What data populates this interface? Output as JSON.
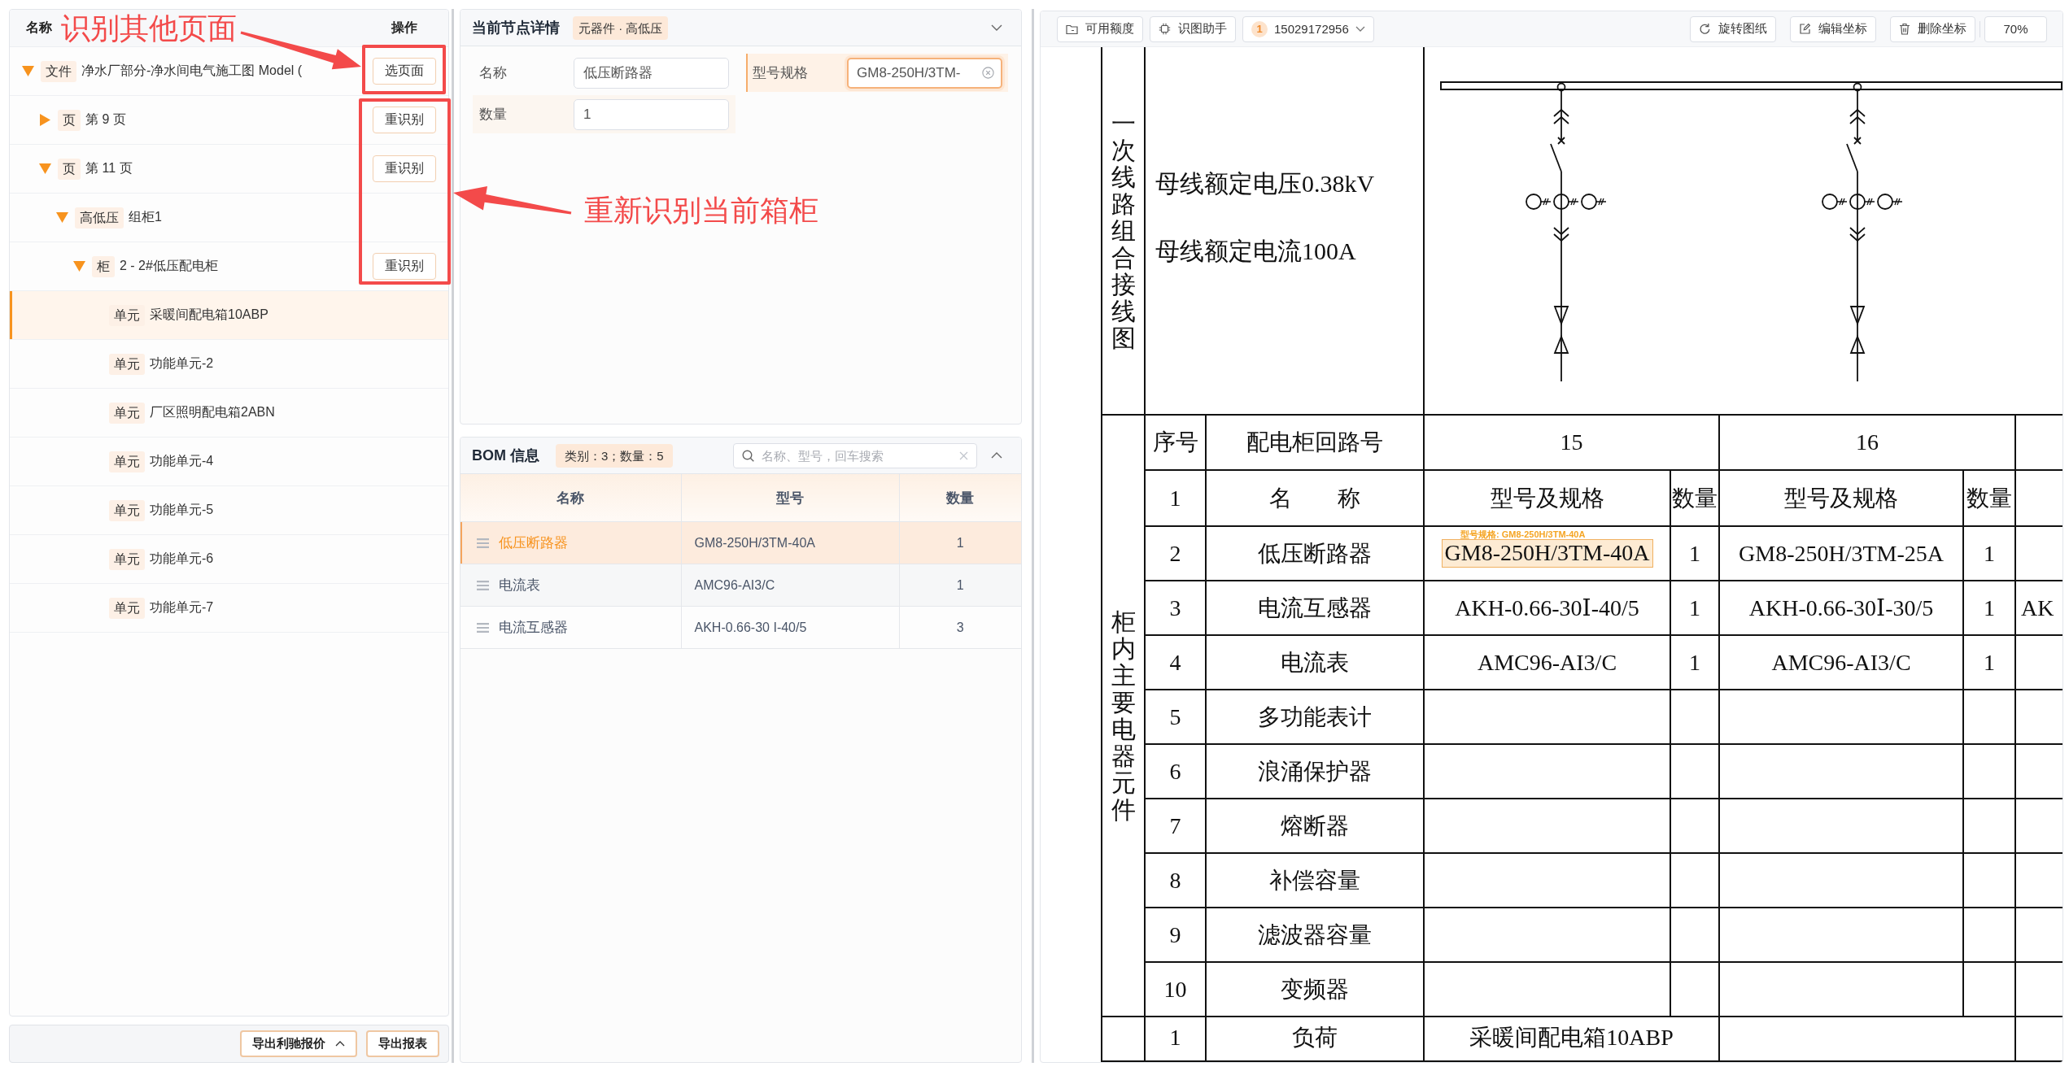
{
  "tree_panel": {
    "columns": [
      "名称",
      "操作"
    ],
    "nodes": [
      {
        "tag": "文件",
        "name": "净水厂部分-净水间电气施工图 Model (",
        "expanded": true,
        "selected": false,
        "action": "选页面",
        "children": [
          {
            "tag": "页",
            "name": "第 9 页",
            "expanded": false,
            "selected": false,
            "action": "重识别"
          },
          {
            "tag": "页",
            "name": "第 11 页",
            "expanded": true,
            "selected": false,
            "action": "重识别",
            "children": [
              {
                "tag": "高低压",
                "name": "组柜1",
                "expanded": true,
                "selected": false,
                "children": [
                  {
                    "tag": "柜",
                    "name": "2 - 2#低压配电柜",
                    "expanded": true,
                    "selected": false,
                    "action": "重识别",
                    "children": [
                      {
                        "tag": "单元",
                        "name": "采暖间配电箱10ABP",
                        "selected": true
                      },
                      {
                        "tag": "单元",
                        "name": "功能单元-2",
                        "selected": false
                      },
                      {
                        "tag": "单元",
                        "name": "厂区照明配电箱2ABN",
                        "selected": false
                      },
                      {
                        "tag": "单元",
                        "name": "功能单元-4",
                        "selected": false
                      },
                      {
                        "tag": "单元",
                        "name": "功能单元-5",
                        "selected": false
                      },
                      {
                        "tag": "单元",
                        "name": "功能单元-6",
                        "selected": false
                      },
                      {
                        "tag": "单元",
                        "name": "功能单元-7",
                        "selected": false
                      }
                    ]
                  }
                ]
              }
            ]
          }
        ]
      }
    ],
    "footer_buttons": [
      {
        "label": "导出利驰报价",
        "has_menu": true
      },
      {
        "label": "导出报表",
        "has_menu": false
      }
    ]
  },
  "detail_card": {
    "title": "当前节点详情",
    "tag": "元器件 · 高低压",
    "fields": [
      {
        "label": "名称",
        "value": "低压断路器",
        "focused": false,
        "hovered": false
      },
      {
        "label": "型号规格",
        "value": "GM8-250H/3TM-",
        "focused": true,
        "hovered": false
      },
      {
        "label": "数量",
        "value": "1",
        "focused": false,
        "hovered": true
      }
    ]
  },
  "bom_card": {
    "title": "BOM 信息",
    "summary": "类别：3；数量：5",
    "search": {
      "placeholder": "名称、型号，回车搜索"
    },
    "table": {
      "columns": [
        "名称",
        "型号",
        "数量"
      ],
      "rows": [
        {
          "name": "低压断路器",
          "model": "GM8-250H/3TM-40A",
          "quantity": "1",
          "selected": true
        },
        {
          "name": "电流表",
          "model": "AMC96-AI3/C",
          "quantity": "1",
          "selected": false
        },
        {
          "name": "电流互感器",
          "model": "AKH-0.66-30 I-40/5",
          "quantity": "3",
          "selected": false
        }
      ]
    }
  },
  "viewer": {
    "toolbar": {
      "left_buttons": [
        "可用额度",
        "识图助手"
      ],
      "account": {
        "badge": "1",
        "number": "15029172956"
      },
      "right_buttons": [
        "旋转图纸",
        "编辑坐标",
        "删除坐标"
      ],
      "zoom": "70%"
    },
    "drawing": {
      "wiring_section": {
        "label": "一次线路组合接线图",
        "notes": [
          "母线额定电压0.38kV",
          "母线额定电流100A"
        ]
      },
      "component_table": {
        "label": "柜内主要电器元件",
        "header": {
          "no": "序号",
          "name": "配电柜回路号",
          "circuits": [
            "15",
            "16"
          ]
        },
        "subheader": {
          "no": "1",
          "name": "名　　称",
          "columns": [
            "型号及规格",
            "数量",
            "型号及规格",
            "数量"
          ]
        },
        "rows": [
          {
            "no": "2",
            "name": "低压断路器",
            "values": [
              {
                "spec": "GM8-250H/3TM-40A",
                "qty": "1",
                "highlighted": true,
                "highlight_label": "型号规格: GM8-250H/3TM-40A"
              },
              {
                "spec": "GM8-250H/3TM-25A",
                "qty": "1",
                "highlighted": false
              }
            ]
          },
          {
            "no": "3",
            "name": "电流互感器",
            "values": [
              {
                "spec": "AKH-0.66-30Ⅰ-40/5",
                "qty": "1",
                "highlighted": false
              },
              {
                "spec": "AKH-0.66-30Ⅰ-30/5",
                "qty": "1",
                "highlighted": false
              }
            ],
            "column_5": "AK"
          },
          {
            "no": "4",
            "name": "电流表",
            "values": [
              {
                "spec": "AMC96-AI3/C",
                "qty": "1",
                "highlighted": false
              },
              {
                "spec": "AMC96-AI3/C",
                "qty": "1",
                "highlighted": false
              }
            ]
          },
          {
            "no": "5",
            "name": "多功能表计"
          },
          {
            "no": "6",
            "name": "浪涌保护器"
          },
          {
            "no": "7",
            "name": "熔断器"
          },
          {
            "no": "8",
            "name": "补偿容量"
          },
          {
            "no": "9",
            "name": "滤波器容量"
          },
          {
            "no": "10",
            "name": "变频器"
          }
        ],
        "load_row": {
          "no": "1",
          "name": "负荷",
          "values": [
            "采暖间配电箱10ABP"
          ]
        }
      }
    }
  },
  "annotations": [
    {
      "text": "识别其他页面"
    },
    {
      "text": "重新识别当前箱柜"
    }
  ]
}
